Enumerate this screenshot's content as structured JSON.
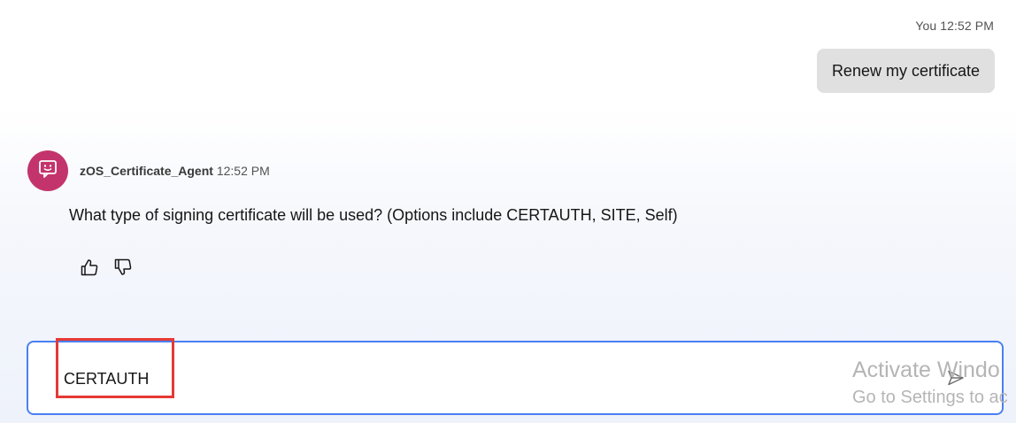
{
  "user_message": {
    "meta": "You 12:52 PM",
    "text": "Renew my certificate"
  },
  "bot_message": {
    "agent_name": "zOS_Certificate_Agent",
    "time": "12:52 PM",
    "text": "What type of signing certificate will be used? (Options include CERTAUTH, SITE, Self)",
    "avatar_icon": "chat-bot-icon",
    "avatar_color": "#c3346d"
  },
  "feedback": {
    "like_icon": "thumbs-up-icon",
    "dislike_icon": "thumbs-down-icon"
  },
  "composer": {
    "value": "CERTAUTH",
    "send_icon": "send-icon",
    "border_color": "#4a7ff2"
  },
  "annotation": {
    "highlight_color": "#e53935"
  },
  "os_watermark": {
    "title": "Activate Windo",
    "subtitle": "Go to Settings to ac"
  }
}
